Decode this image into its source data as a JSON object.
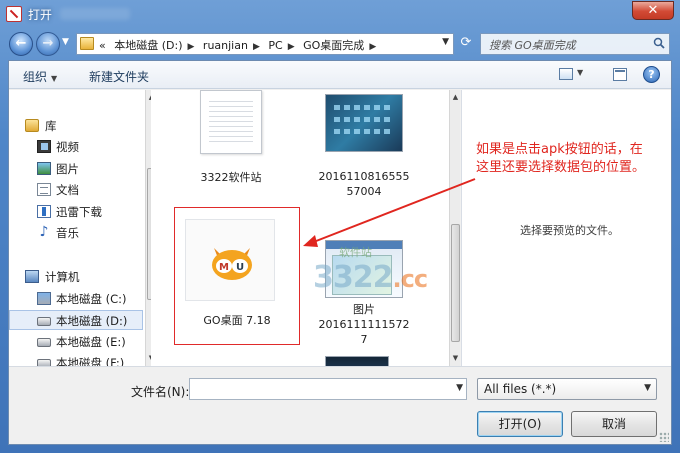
{
  "window": {
    "title": "打开"
  },
  "address": {
    "crumbs": [
      "本地磁盘 (D:)",
      "ruanjian",
      "PC",
      "GO桌面完成"
    ],
    "prefix": "«"
  },
  "search": {
    "placeholder": "搜索 GO桌面完成"
  },
  "toolbar": {
    "organize": "组织",
    "new_folder": "新建文件夹"
  },
  "nav": {
    "library": "库",
    "videos": "视频",
    "pictures": "图片",
    "documents": "文档",
    "downloads": "迅雷下载",
    "music": "音乐",
    "computer": "计算机",
    "drive_c": "本地磁盘 (C:)",
    "drive_d": "本地磁盘 (D:)",
    "drive_e": "本地磁盘 (E:)",
    "drive_f": "本地磁盘 (F:)"
  },
  "files": [
    {
      "name": "3322软件站",
      "kind": "document"
    },
    {
      "name": "2016110816555 57004",
      "line1": "2016110816555",
      "line2": "57004",
      "kind": "screenshot"
    },
    {
      "name": "GO桌面 7.18",
      "kind": "app",
      "selected": true
    },
    {
      "name": "图片 2016111111572 7",
      "line1": "图片",
      "line2": "2016111111572",
      "line3": "7",
      "kind": "screenshot"
    },
    {
      "name": "",
      "kind": "screenshot-partial"
    }
  ],
  "preview": {
    "empty_text": "选择要预览的文件。"
  },
  "annotation": {
    "line1": "如果是点击apk按钮的话，在",
    "line2": "这里还要选择数据包的位置。",
    "color": "#e0261f"
  },
  "watermark": {
    "main": "3322",
    "suffix": ".cc",
    "sub": "软件站"
  },
  "bottom": {
    "filename_label": "文件名(N):",
    "filename_value": "",
    "filetype_value": "All files (*.*)",
    "open_label": "打开(O)",
    "cancel_label": "取消"
  }
}
